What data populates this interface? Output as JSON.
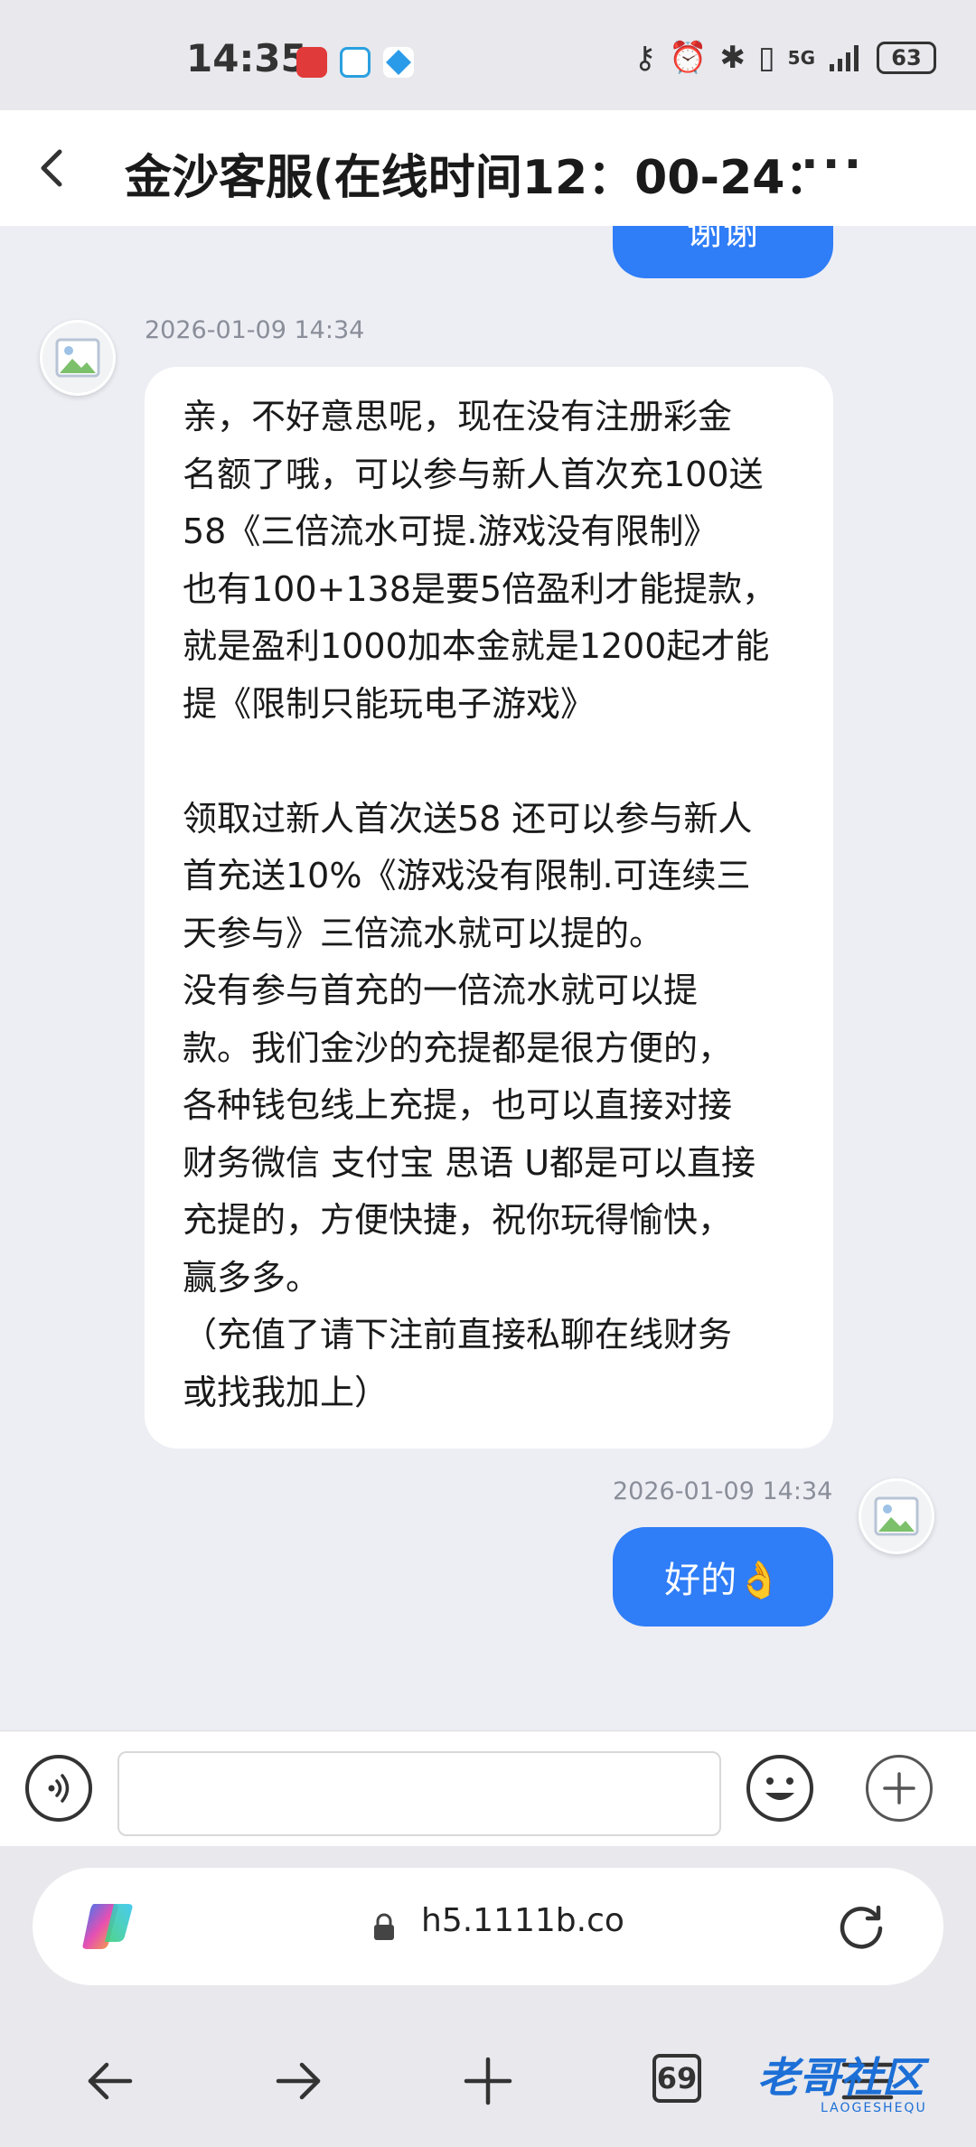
{
  "status_bar": {
    "time": "14:35",
    "network": "5G",
    "battery": "63",
    "icons": [
      "huawei-app-icon",
      "app-icon-2",
      "app-icon-3",
      "key-icon",
      "alarm-icon",
      "bluetooth-icon",
      "vibrate-icon",
      "signal-icon"
    ]
  },
  "header": {
    "title": "金沙客服(在线时间12：00-24：",
    "more": "···"
  },
  "messages": [
    {
      "side": "out",
      "text": "谢谢"
    },
    {
      "side": "in",
      "timestamp": "2026-01-09 14:34",
      "text": "亲，不好意思呢，现在没有注册彩金\n名额了哦，可以参与新人首次充100送\n58《三倍流水可提.游戏没有限制》\n也有100+138是要5倍盈利才能提款，\n就是盈利1000加本金就是1200起才能\n提《限制只能玩电子游戏》\n\n领取过新人首次送58 还可以参与新人\n首充送10%《游戏没有限制.可连续三\n天参与》三倍流水就可以提的。\n没有参与首充的一倍流水就可以提\n款。我们金沙的充提都是很方便的，\n各种钱包线上充提，也可以直接对接\n财务微信 支付宝 思语 U都是可以直接\n充提的，方便快捷，祝你玩得愉快，\n赢多多。\n（充值了请下注前直接私聊在线财务\n或找我加上）"
    },
    {
      "side": "out",
      "timestamp": "2026-01-09 14:34",
      "text": "好的👌"
    }
  ],
  "input_bar": {
    "value": "",
    "placeholder": ""
  },
  "browser": {
    "url": "h5.1111b.co",
    "tab_count": "69"
  },
  "watermark": {
    "text": "老哥社区",
    "sub": "LAOGESHEQU"
  },
  "colors": {
    "accent": "#2f7df7",
    "chat_bg": "#edeef4",
    "bubble_in": "#ffffff"
  }
}
